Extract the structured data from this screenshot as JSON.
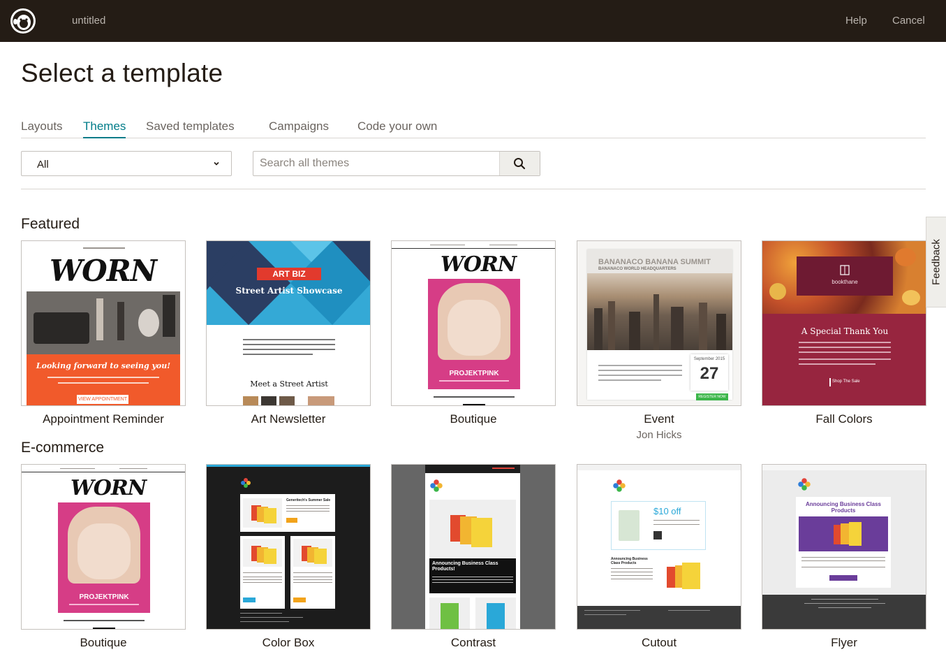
{
  "app": {
    "document_title": "untitled",
    "help_label": "Help",
    "cancel_label": "Cancel"
  },
  "page": {
    "title": "Select a template"
  },
  "tabs": [
    {
      "label": "Layouts",
      "active": false
    },
    {
      "label": "Themes",
      "active": true
    },
    {
      "label": "Saved templates",
      "active": false
    },
    {
      "label": "Campaigns",
      "active": false
    },
    {
      "label": "Code your own",
      "active": false
    }
  ],
  "filters": {
    "category_selected": "All",
    "search_placeholder": "Search all themes"
  },
  "feedback_label": "Feedback",
  "sections": {
    "featured": {
      "title": "Featured",
      "items": [
        {
          "name": "Appointment Reminder",
          "author": ""
        },
        {
          "name": "Art Newsletter",
          "author": ""
        },
        {
          "name": "Boutique",
          "author": ""
        },
        {
          "name": "Event",
          "author": "Jon Hicks"
        },
        {
          "name": "Fall Colors",
          "author": ""
        }
      ]
    },
    "ecommerce": {
      "title": "E-commerce",
      "items": [
        {
          "name": "Boutique"
        },
        {
          "name": "Color Box"
        },
        {
          "name": "Contrast"
        },
        {
          "name": "Cutout"
        },
        {
          "name": "Flyer"
        }
      ]
    }
  },
  "thumbs": {
    "worn_logo": "WORN",
    "appointment_tagline": "Looking forward to seeing you!",
    "appointment_button": "VIEW APPOINTMENT",
    "art_brand": "ART BIZ",
    "art_headline": "Street Artist Showcase",
    "art_sub": "Meet a Street Artist",
    "boutique_banner": "PROJEKTPINK",
    "event_title": "BANANACO BANANA SUMMIT",
    "event_sub": "BANANACO WORLD HEADQUARTERS",
    "event_month": "September 2015",
    "event_day": "27",
    "event_button": "REGISTER NOW",
    "fall_brand": "bookthane",
    "fall_headline": "A Special Thank You",
    "fall_button": "Shop The Sale",
    "colorbox_heading": "Generitech's Summer Sale",
    "contrast_heading": "Announcing Business Class Products!",
    "cutout_price": "$10 off",
    "cutout_heading": "Announcing Business Class Products",
    "flyer_heading": "Announcing Business Class Products"
  },
  "colors": {
    "topbar": "#241c15",
    "accent": "#007c89",
    "appointment_orange": "#f15a2b",
    "boutique_pink": "#d63d86",
    "fall_maroon": "#97253f",
    "event_green": "#3cb64a"
  }
}
